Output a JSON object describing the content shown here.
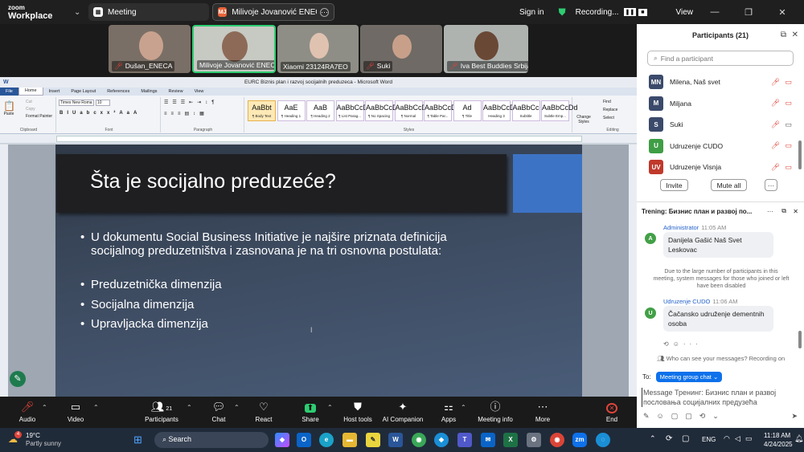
{
  "app": {
    "logo_top": "zoom",
    "logo_bottom": "Workplace"
  },
  "tabs": [
    {
      "label": "Meeting"
    },
    {
      "label": "Milivoje Jovanović ENECA's scree",
      "initials": "MJ"
    }
  ],
  "topright": {
    "sign_in": "Sign in",
    "recording": "Recording...",
    "view": "View"
  },
  "participants_tiles": [
    {
      "name": "Dušan_ENECA",
      "muted": true
    },
    {
      "name": "Milivoje Jovanović ENECA",
      "muted": false,
      "active": true
    },
    {
      "name": "Xiaomi 23124RA7EO",
      "muted": false
    },
    {
      "name": "Suki",
      "muted": true
    },
    {
      "name": "Iva Best Buddies Srbija",
      "muted": true
    }
  ],
  "word": {
    "title": "EURC Biznis plan i razvoj socijalnih preduzeca - Microsoft Word",
    "ribbon_tabs": [
      "File",
      "Home",
      "Insert",
      "Page Layout",
      "References",
      "Mailings",
      "Review",
      "View"
    ],
    "font_name": "Times New Roma",
    "font_size": "10",
    "groups": [
      "Clipboard",
      "Font",
      "Paragraph",
      "Styles",
      "Editing"
    ],
    "clipboard": [
      "Paste",
      "Cut",
      "Copy",
      "Format Painter"
    ],
    "styles": [
      {
        "sample": "AaBbt",
        "name": "¶ Body Text",
        "selected": true
      },
      {
        "sample": "AaE",
        "name": "¶ Heading 1"
      },
      {
        "sample": "AaB",
        "name": "¶ Heading 2"
      },
      {
        "sample": "AaBbCcDd",
        "name": "¶ List Parag..."
      },
      {
        "sample": "AaBbCcDd",
        "name": "¶ No Spacing"
      },
      {
        "sample": "AaBbCcDd",
        "name": "¶ Normal"
      },
      {
        "sample": "AaBbCcDc",
        "name": "¶ Table Par..."
      },
      {
        "sample": "Ad",
        "name": "¶ Title"
      },
      {
        "sample": "AaBbCcD",
        "name": "Heading 3"
      },
      {
        "sample": "AaBbCc",
        "name": "Subtitle"
      },
      {
        "sample": "AaBbCcDd",
        "name": "Subtle Emp..."
      }
    ],
    "change_styles": "Change Styles",
    "editing": [
      "Find",
      "Replace",
      "Select"
    ]
  },
  "slide": {
    "title": "Šta je socijalno preduzeće?",
    "bullets": [
      "U dokumentu Social Business Initiative je najšire priznata definicija socijalnog preduzetništva i zasnovana je na tri osnovna postulata:",
      "Preduzetnička dimenzija",
      "Socijalna dimenzija",
      "Upravljacka dimenzija"
    ]
  },
  "panel": {
    "title": "Participants (21)",
    "search_placeholder": "Find a participant",
    "list": [
      {
        "initials": "MN",
        "name": "Milena, Naš svet",
        "color": "#3b4a6b"
      },
      {
        "initials": "M",
        "name": "Miljana",
        "color": "#3b4a6b"
      },
      {
        "initials": "S",
        "name": "Suki",
        "color": "#3b4a6b"
      },
      {
        "initials": "U",
        "name": "Udruzenje CUDO",
        "color": "#3f9e45"
      },
      {
        "initials": "UV",
        "name": "Udruzenje Visnja",
        "color": "#c0392b"
      }
    ],
    "invite": "Invite",
    "mute_all": "Mute all",
    "more": "···"
  },
  "chat": {
    "title": "Trening: Бизнис план и развој по...",
    "messages": [
      {
        "sender": "Administrator",
        "time": "11:05 AM",
        "text": "Danijela Gašić Naš Svet Leskovac",
        "initial": "A",
        "color": "#43a047"
      },
      {
        "sender": "Udruzenje CUDO",
        "time": "11:06 AM",
        "text": "Čačansko udruženje dementnih osoba",
        "initial": "U",
        "color": "#43a047"
      }
    ],
    "system": "Due to the large number of participants in this meeting, system messages for those who joined or left have been disabled",
    "visibility": "Who can see your messages? Recording on",
    "to_label": "To:",
    "to_value": "Meeting group chat",
    "input_placeholder": "Message Тренинг: Бизнис план и развој пословања социјалних предузећа"
  },
  "controls": [
    {
      "label": "Audio",
      "glyph": "🎙"
    },
    {
      "label": "Video",
      "glyph": "▭"
    },
    {
      "label": "Participants",
      "glyph": "👥",
      "count": "21"
    },
    {
      "label": "Chat",
      "glyph": "💬"
    },
    {
      "label": "React",
      "glyph": "♡"
    },
    {
      "label": "Share",
      "glyph": "⬆"
    },
    {
      "label": "Host tools",
      "glyph": "⛊"
    },
    {
      "label": "AI Companion",
      "glyph": "✦"
    },
    {
      "label": "Apps",
      "glyph": "⚏"
    },
    {
      "label": "Meeting info",
      "glyph": "ⓘ"
    },
    {
      "label": "More",
      "glyph": "···"
    },
    {
      "label": "End",
      "glyph": "✕"
    }
  ],
  "taskbar": {
    "weather_temp": "19°C",
    "weather_desc": "Partly sunny",
    "weather_badge": "4",
    "search": "Search",
    "lang": "ENG",
    "time": "11:18 AM",
    "date": "4/24/2025"
  }
}
